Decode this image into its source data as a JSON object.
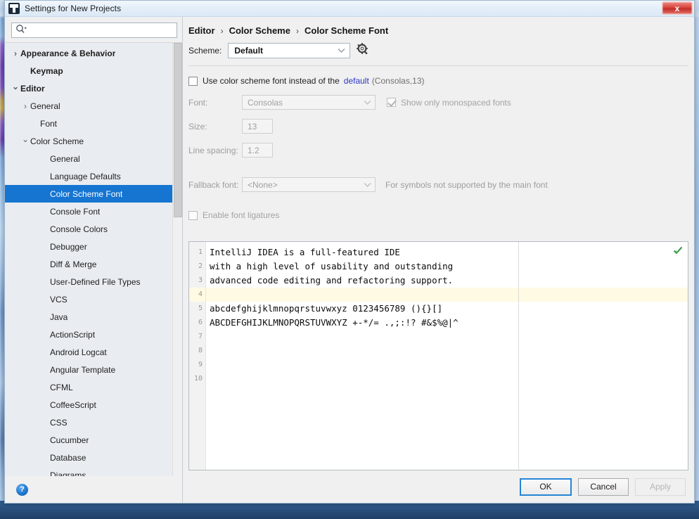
{
  "window": {
    "title": "Settings for New Projects",
    "app_icon": "intellij-idea-icon",
    "close_label": "x"
  },
  "sidebar": {
    "search": {
      "value": "",
      "placeholder": "",
      "icon": "search-icon"
    },
    "help_label": "?",
    "items": [
      {
        "label": "Appearance & Behavior",
        "indent": 0,
        "twisty": "›",
        "bold": true,
        "selected": false
      },
      {
        "label": "Keymap",
        "indent": 1,
        "twisty": "",
        "bold": true,
        "selected": false
      },
      {
        "label": "Editor",
        "indent": 0,
        "twisty": "⌄",
        "bold": true,
        "selected": false
      },
      {
        "label": "General",
        "indent": 1,
        "twisty": "›",
        "bold": false,
        "selected": false
      },
      {
        "label": "Font",
        "indent": 2,
        "twisty": "",
        "bold": false,
        "selected": false
      },
      {
        "label": "Color Scheme",
        "indent": 1,
        "twisty": "⌄",
        "bold": false,
        "selected": false
      },
      {
        "label": "General",
        "indent": 3,
        "twisty": "",
        "bold": false,
        "selected": false
      },
      {
        "label": "Language Defaults",
        "indent": 3,
        "twisty": "",
        "bold": false,
        "selected": false
      },
      {
        "label": "Color Scheme Font",
        "indent": 3,
        "twisty": "",
        "bold": false,
        "selected": true
      },
      {
        "label": "Console Font",
        "indent": 3,
        "twisty": "",
        "bold": false,
        "selected": false
      },
      {
        "label": "Console Colors",
        "indent": 3,
        "twisty": "",
        "bold": false,
        "selected": false
      },
      {
        "label": "Debugger",
        "indent": 3,
        "twisty": "",
        "bold": false,
        "selected": false
      },
      {
        "label": "Diff & Merge",
        "indent": 3,
        "twisty": "",
        "bold": false,
        "selected": false
      },
      {
        "label": "User-Defined File Types",
        "indent": 3,
        "twisty": "",
        "bold": false,
        "selected": false
      },
      {
        "label": "VCS",
        "indent": 3,
        "twisty": "",
        "bold": false,
        "selected": false
      },
      {
        "label": "Java",
        "indent": 3,
        "twisty": "",
        "bold": false,
        "selected": false
      },
      {
        "label": "ActionScript",
        "indent": 3,
        "twisty": "",
        "bold": false,
        "selected": false
      },
      {
        "label": "Android Logcat",
        "indent": 3,
        "twisty": "",
        "bold": false,
        "selected": false
      },
      {
        "label": "Angular Template",
        "indent": 3,
        "twisty": "",
        "bold": false,
        "selected": false
      },
      {
        "label": "CFML",
        "indent": 3,
        "twisty": "",
        "bold": false,
        "selected": false
      },
      {
        "label": "CoffeeScript",
        "indent": 3,
        "twisty": "",
        "bold": false,
        "selected": false
      },
      {
        "label": "CSS",
        "indent": 3,
        "twisty": "",
        "bold": false,
        "selected": false
      },
      {
        "label": "Cucumber",
        "indent": 3,
        "twisty": "",
        "bold": false,
        "selected": false
      },
      {
        "label": "Database",
        "indent": 3,
        "twisty": "",
        "bold": false,
        "selected": false
      },
      {
        "label": "Diagrams",
        "indent": 3,
        "twisty": "",
        "bold": false,
        "selected": false
      }
    ]
  },
  "main": {
    "breadcrumb": [
      "Editor",
      "Color Scheme",
      "Color Scheme Font"
    ],
    "breadcrumb_separator": "›",
    "scheme": {
      "label": "Scheme:",
      "value": "Default",
      "gear_icon": "gear-icon",
      "chevron_icon": "chevron-down-icon"
    },
    "use_scheme_font": {
      "checked": false,
      "text_before": "Use color scheme font instead of the",
      "link": "default",
      "text_after": "(Consolas,13)"
    },
    "font": {
      "label": "Font:",
      "value": "Consolas",
      "monospaced_checkbox": {
        "label": "Show only monospaced fonts",
        "checked": true
      }
    },
    "size": {
      "label": "Size:",
      "value": "13"
    },
    "line_spacing": {
      "label": "Line spacing:",
      "value": "1.2"
    },
    "fallback_font": {
      "label": "Fallback font:",
      "value": "<None>",
      "note": "For symbols not supported by the main font"
    },
    "ligatures": {
      "label": "Enable font ligatures",
      "checked": false
    }
  },
  "preview": {
    "valid_icon": "green-check-icon",
    "line_numbers": [
      "1",
      "2",
      "3",
      "4",
      "5",
      "6",
      "7",
      "8",
      "9",
      "10"
    ],
    "caret_line": 4,
    "lines": [
      "IntelliJ IDEA is a full-featured IDE",
      "with a high level of usability and outstanding",
      "advanced code editing and refactoring support.",
      "",
      "abcdefghijklmnopqrstuvwxyz 0123456789 (){}[]",
      "ABCDEFGHIJKLMNOPQRSTUVWXYZ +-*/= .,;:!? #&$%@|^",
      "",
      "",
      "",
      ""
    ]
  },
  "footer": {
    "ok": "OK",
    "cancel": "Cancel",
    "apply": "Apply"
  },
  "colors": {
    "selection": "#1675d1",
    "link": "#2b36c8",
    "caret_row": "#fffae3",
    "close_button": "#d9443c"
  }
}
